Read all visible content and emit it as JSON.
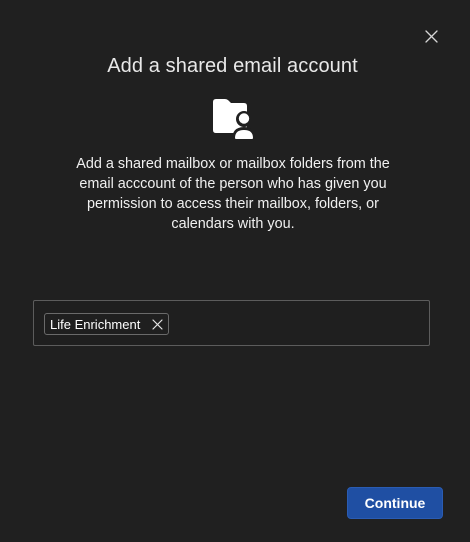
{
  "dialog": {
    "title": "Add a shared email account",
    "description": "Add a shared mailbox or mailbox folders from the email acccount of the person who has given you permission to access their mailbox, folders, or calendars with you.",
    "hero_icon": "shared-folder-person-icon",
    "close_icon": "close-icon"
  },
  "recipient_field": {
    "chips": [
      {
        "label": "Life Enrichment",
        "remove_icon": "dismiss-icon"
      }
    ],
    "value": ""
  },
  "actions": {
    "continue_label": "Continue"
  },
  "colors": {
    "background": "#202020",
    "primary_button": "#1f4fa3",
    "border": "#5c5c5c",
    "text": "#ffffff"
  }
}
